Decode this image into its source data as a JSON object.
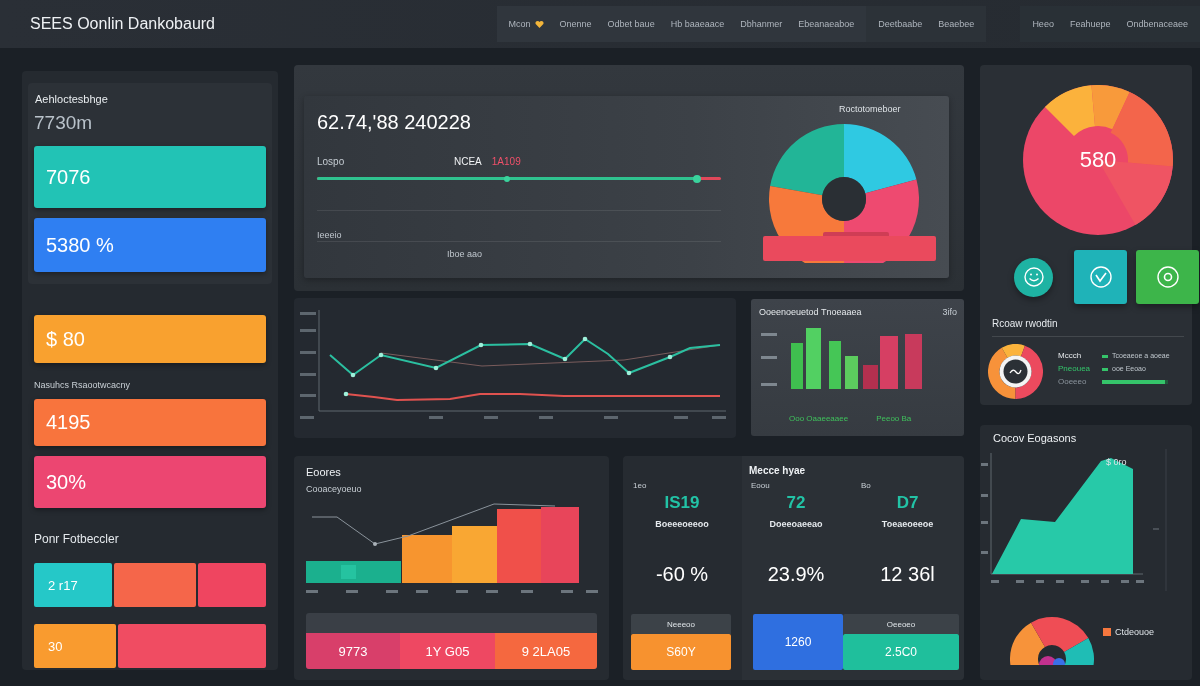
{
  "header": {
    "title": "SEES Oonlin Dankobaurd",
    "nav_groups": [
      {
        "items": [
          {
            "kind": "with-icon",
            "label": "Mcon"
          },
          {
            "kind": "plain",
            "label": "Onenne"
          },
          {
            "kind": "plain",
            "label": "Odbet baue"
          },
          {
            "kind": "plain",
            "label": "Hb baaeaace"
          },
          {
            "kind": "plain",
            "label": "Dbhanmer"
          },
          {
            "kind": "plain",
            "label": "Ebeanaeaboe"
          }
        ]
      },
      {
        "items": [
          {
            "kind": "plain",
            "label": "Deetbaabe"
          },
          {
            "kind": "plain",
            "label": "Beaebee"
          }
        ]
      },
      {
        "items": [
          {
            "kind": "plain",
            "label": "Heeo"
          },
          {
            "kind": "plain",
            "label": "Feahuepe"
          },
          {
            "kind": "plain",
            "label": "Ondbenaceaee"
          }
        ]
      }
    ]
  },
  "left_panel": {
    "title": "Aehloctesbhge",
    "value": "7730m",
    "top_cards": [
      {
        "value": "7076",
        "color": "#22c3b5"
      },
      {
        "value": "5380 %",
        "color": "#2f7ff2"
      }
    ],
    "groups": [
      {
        "kind": "cards",
        "cards": [
          {
            "value": "$ 80",
            "color": "#f9a12f"
          }
        ]
      },
      {
        "kind": "cards",
        "heading": "Nasuhcs Rsaootwcacny",
        "cards": [
          {
            "value": "4195",
            "color": "#f8743d"
          },
          {
            "value": "30%",
            "color": "#ec4671"
          }
        ]
      },
      {
        "kind": "split",
        "heading": "Ponr Fotbeccler",
        "bars": [
          {
            "segments": [
              {
                "value": "2 r17",
                "color": "#25c8c8"
              },
              {
                "color": "#f5664a"
              },
              {
                "color": "#ef4560"
              }
            ]
          },
          {
            "segments": [
              {
                "value": "30",
                "color": "#f99b2f"
              },
              {
                "color": "#f04c62"
              }
            ]
          }
        ]
      }
    ]
  },
  "summary_panel": {
    "value": "62.74,'88 240228",
    "labels": [
      {
        "kind": "muted",
        "text": "Lospo"
      },
      {
        "kind": "plain",
        "text": "NCEA"
      },
      {
        "kind": "alert",
        "text": "1A109"
      }
    ],
    "progress": {
      "level": 0.94
    },
    "axis_labels": [
      "Ieeeio",
      "Iboe aao"
    ],
    "donut_title": "Roctotomeboer"
  },
  "bar_panel": {
    "title": "Ooeenoeuetod Tnoeaaea",
    "value": "3ifo",
    "legend": [
      "Ooo Oaaeeaaee",
      "Peeoo Ba"
    ]
  },
  "sources_panel": {
    "title": "Eoores",
    "subtitle": "Cooaceyoeuo",
    "segments": [
      {
        "value": "9773",
        "color": "#d83f6a"
      },
      {
        "value": "1Y G05",
        "color": "#ee4862"
      },
      {
        "value": "9 2LA05",
        "color": "#f5683f"
      }
    ]
  },
  "metrics_panel": {
    "title": "Mecce hyae",
    "columns": [
      {
        "label": "1eo",
        "value": "IS19",
        "caption": "Boeeeoeeoo",
        "change": "-60 %"
      },
      {
        "label": "Eoou",
        "value": "72",
        "caption": "Doeeoaeeao",
        "change": "23.9%"
      },
      {
        "label": "Bo",
        "value": "D7",
        "caption": "Toeaeoeeoe",
        "change": "12 36l"
      }
    ],
    "tiles": [
      {
        "header": "Neeeoo",
        "value": "S60Y",
        "color": "#f7922f"
      },
      {
        "value": "1260",
        "color": "#2f6fe0"
      },
      {
        "header": "Oeeoeo",
        "value": "2.5C0",
        "color": "#1fbf9c"
      }
    ]
  },
  "gauge_panel": {
    "value": "580",
    "tiles": [
      {
        "kind": "round",
        "color": "#1eb3a3"
      },
      {
        "kind": "square",
        "color": "#1fb3b8"
      },
      {
        "kind": "square",
        "color": "#3db54a"
      }
    ],
    "heading": "Rcoaw rwodtin",
    "legend": [
      {
        "kind": "strong",
        "label": "Mccch"
      },
      {
        "kind": "positive",
        "label": "Pneouea"
      },
      {
        "kind": "muted",
        "label": "Ooeeeo"
      }
    ],
    "notes": [
      {
        "kind": "entry",
        "text": "Tcoeaeoe a aoeae"
      },
      {
        "kind": "entry",
        "text": "ooe Eeoao"
      },
      {
        "kind": "bar",
        "level": 0.95
      }
    ]
  },
  "growth_panel": {
    "title": "Cocov Eogasons",
    "value": "$ 0ro",
    "legend": "Ctdeouoe"
  }
}
